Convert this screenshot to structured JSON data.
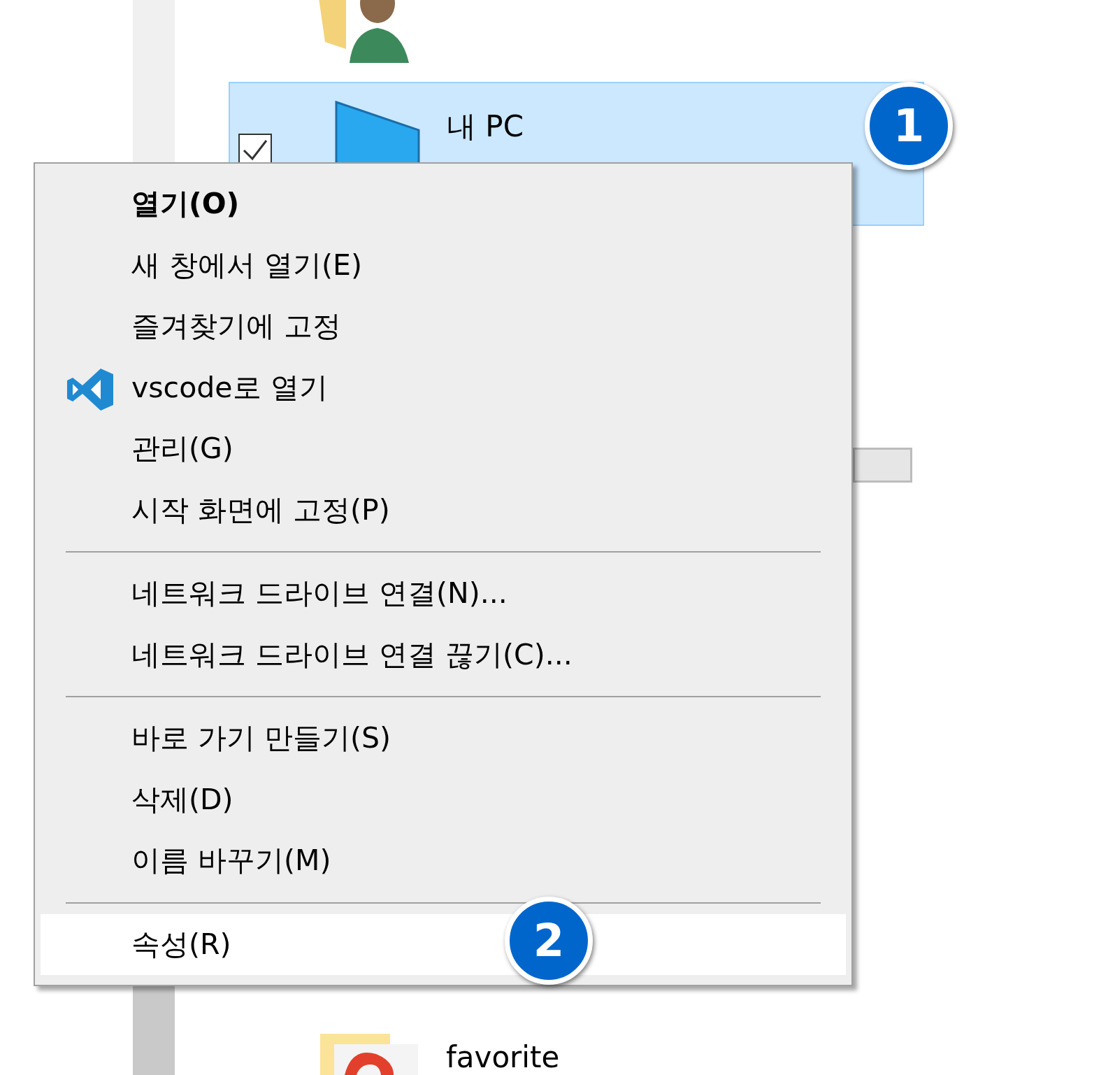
{
  "explorer": {
    "selected_item": {
      "label": "내 PC",
      "checked": true,
      "selected": true
    },
    "bottom_item": {
      "label": "favorite"
    }
  },
  "context_menu": [
    {
      "kind": "item",
      "label": "열기(O)",
      "default": true,
      "selected": false
    },
    {
      "kind": "item",
      "label": "새 창에서 열기(E)",
      "default": false,
      "selected": false
    },
    {
      "kind": "item",
      "label": "즐겨찾기에 고정",
      "default": false,
      "selected": false
    },
    {
      "kind": "icon_item",
      "label": "vscode로 열기",
      "default": false,
      "selected": false
    },
    {
      "kind": "item",
      "label": "관리(G)",
      "default": false,
      "selected": false
    },
    {
      "kind": "item",
      "label": "시작 화면에 고정(P)",
      "default": false,
      "selected": false
    },
    {
      "kind": "separator"
    },
    {
      "kind": "item",
      "label": "네트워크 드라이브 연결(N)...",
      "default": false,
      "selected": false
    },
    {
      "kind": "item",
      "label": "네트워크 드라이브 연결 끊기(C)...",
      "default": false,
      "selected": false
    },
    {
      "kind": "separator"
    },
    {
      "kind": "item",
      "label": "바로 가기 만들기(S)",
      "default": false,
      "selected": false
    },
    {
      "kind": "item",
      "label": "삭제(D)",
      "default": false,
      "selected": false
    },
    {
      "kind": "item",
      "label": "이름 바꾸기(M)",
      "default": false,
      "selected": false
    },
    {
      "kind": "separator"
    },
    {
      "kind": "item",
      "label": "속성(R)",
      "default": false,
      "selected": true
    }
  ],
  "callouts": [
    "1",
    "2"
  ]
}
